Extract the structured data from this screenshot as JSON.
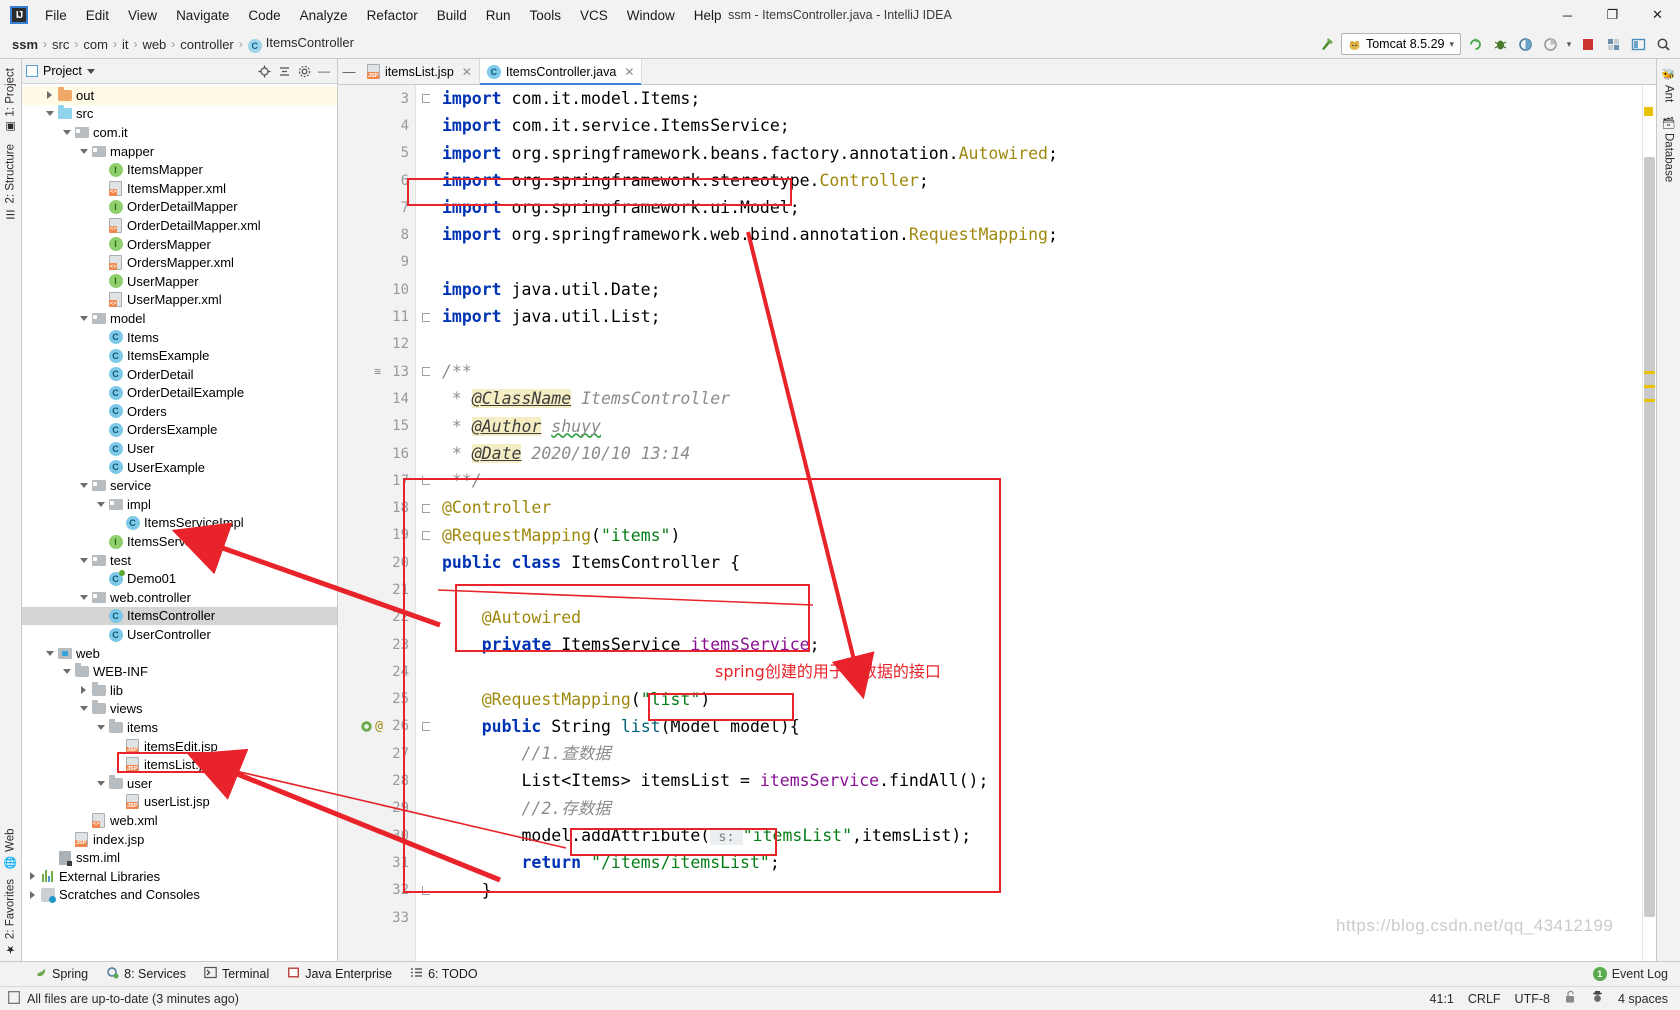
{
  "window": {
    "title": "ssm - ItemsController.java - IntelliJ IDEA",
    "minimize": "─",
    "maximize": "❐",
    "close": "✕"
  },
  "menu": {
    "items": [
      {
        "label": "File"
      },
      {
        "label": "Edit"
      },
      {
        "label": "View"
      },
      {
        "label": "Navigate"
      },
      {
        "label": "Code"
      },
      {
        "label": "Analyze"
      },
      {
        "label": "Refactor"
      },
      {
        "label": "Build"
      },
      {
        "label": "Run"
      },
      {
        "label": "Tools"
      },
      {
        "label": "VCS"
      },
      {
        "label": "Window"
      },
      {
        "label": "Help"
      }
    ]
  },
  "breadcrumb": {
    "items": [
      "ssm",
      "src",
      "com",
      "it",
      "web",
      "controller",
      "ItemsController"
    ],
    "separator": "›",
    "class_icon_letter": "C"
  },
  "toolbar": {
    "run_config": "Tomcat 8.5.29",
    "run_config_caret": "▾",
    "build_icon": "build-hammer-icon",
    "rerun_label": "↻",
    "debug_label": "🐞",
    "coverage_label": "◴",
    "profile_label": "◔",
    "stop_label": "■",
    "structure_label": "☰",
    "layout_label": "▣",
    "search_label": "🔍"
  },
  "project_panel": {
    "title": "Project",
    "caret": "▾",
    "actions": [
      "locate-icon",
      "collapse-all-icon",
      "settings-gear-icon",
      "hide-icon"
    ],
    "tree": [
      {
        "label": "out",
        "depth": 1,
        "twist": "right",
        "icon": "folder-orange",
        "highlight": true
      },
      {
        "label": "src",
        "depth": 1,
        "twist": "down",
        "icon": "source-folder-blue"
      },
      {
        "label": "com.it",
        "depth": 2,
        "twist": "down",
        "icon": "package"
      },
      {
        "label": "mapper",
        "depth": 3,
        "twist": "down",
        "icon": "package"
      },
      {
        "label": "ItemsMapper",
        "depth": 4,
        "twist": "none",
        "icon": "interface"
      },
      {
        "label": "ItemsMapper.xml",
        "depth": 4,
        "twist": "none",
        "icon": "xml-file"
      },
      {
        "label": "OrderDetailMapper",
        "depth": 4,
        "twist": "none",
        "icon": "interface"
      },
      {
        "label": "OrderDetailMapper.xml",
        "depth": 4,
        "twist": "none",
        "icon": "xml-file"
      },
      {
        "label": "OrdersMapper",
        "depth": 4,
        "twist": "none",
        "icon": "interface"
      },
      {
        "label": "OrdersMapper.xml",
        "depth": 4,
        "twist": "none",
        "icon": "xml-file"
      },
      {
        "label": "UserMapper",
        "depth": 4,
        "twist": "none",
        "icon": "interface"
      },
      {
        "label": "UserMapper.xml",
        "depth": 4,
        "twist": "none",
        "icon": "xml-file"
      },
      {
        "label": "model",
        "depth": 3,
        "twist": "down",
        "icon": "package"
      },
      {
        "label": "Items",
        "depth": 4,
        "twist": "none",
        "icon": "class"
      },
      {
        "label": "ItemsExample",
        "depth": 4,
        "twist": "none",
        "icon": "class"
      },
      {
        "label": "OrderDetail",
        "depth": 4,
        "twist": "none",
        "icon": "class"
      },
      {
        "label": "OrderDetailExample",
        "depth": 4,
        "twist": "none",
        "icon": "class"
      },
      {
        "label": "Orders",
        "depth": 4,
        "twist": "none",
        "icon": "class"
      },
      {
        "label": "OrdersExample",
        "depth": 4,
        "twist": "none",
        "icon": "class"
      },
      {
        "label": "User",
        "depth": 4,
        "twist": "none",
        "icon": "class"
      },
      {
        "label": "UserExample",
        "depth": 4,
        "twist": "none",
        "icon": "class"
      },
      {
        "label": "service",
        "depth": 3,
        "twist": "down",
        "icon": "package"
      },
      {
        "label": "impl",
        "depth": 4,
        "twist": "down",
        "icon": "package"
      },
      {
        "label": "ItemsServiceImpl",
        "depth": 5,
        "twist": "none",
        "icon": "class"
      },
      {
        "label": "ItemsService",
        "depth": 4,
        "twist": "none",
        "icon": "interface"
      },
      {
        "label": "test",
        "depth": 3,
        "twist": "down",
        "icon": "package"
      },
      {
        "label": "Demo01",
        "depth": 4,
        "twist": "none",
        "icon": "test-class"
      },
      {
        "label": "web.controller",
        "depth": 3,
        "twist": "down",
        "icon": "package"
      },
      {
        "label": "ItemsController",
        "depth": 4,
        "twist": "none",
        "icon": "class",
        "selected": true
      },
      {
        "label": "UserController",
        "depth": 4,
        "twist": "none",
        "icon": "class"
      },
      {
        "label": "web",
        "depth": 1,
        "twist": "down",
        "icon": "web-module"
      },
      {
        "label": "WEB-INF",
        "depth": 2,
        "twist": "down",
        "icon": "folder-gray"
      },
      {
        "label": "lib",
        "depth": 3,
        "twist": "right",
        "icon": "folder-gray"
      },
      {
        "label": "views",
        "depth": 3,
        "twist": "down",
        "icon": "folder-gray"
      },
      {
        "label": "items",
        "depth": 4,
        "twist": "down",
        "icon": "folder-gray"
      },
      {
        "label": "itemsEdit.jsp",
        "depth": 5,
        "twist": "none",
        "icon": "jsp-file"
      },
      {
        "label": "itemsList.jsp",
        "depth": 5,
        "twist": "none",
        "icon": "jsp-file",
        "annotated": true
      },
      {
        "label": "user",
        "depth": 4,
        "twist": "down",
        "icon": "folder-gray"
      },
      {
        "label": "userList.jsp",
        "depth": 5,
        "twist": "none",
        "icon": "jsp-file"
      },
      {
        "label": "web.xml",
        "depth": 3,
        "twist": "none",
        "icon": "xml-file"
      },
      {
        "label": "index.jsp",
        "depth": 2,
        "twist": "none",
        "icon": "jsp-file"
      },
      {
        "label": "ssm.iml",
        "depth": 1,
        "twist": "none",
        "icon": "iml-file"
      },
      {
        "label": "External Libraries",
        "depth": 0,
        "twist": "right",
        "icon": "library"
      },
      {
        "label": "Scratches and Consoles",
        "depth": 0,
        "twist": "right",
        "icon": "scratch"
      }
    ]
  },
  "left_strips": [
    {
      "label": "1: Project",
      "icon": "project-icon"
    },
    {
      "label": "2: Structure",
      "icon": "structure-icon"
    }
  ],
  "left_strips_bottom": [
    {
      "label": "Web",
      "icon": "globe-icon"
    },
    {
      "label": "2: Favorites",
      "icon": "star-icon"
    }
  ],
  "right_strips": [
    {
      "label": "Ant",
      "icon": "ant-icon"
    },
    {
      "label": "Database",
      "icon": "database-icon"
    }
  ],
  "editor": {
    "tabs": [
      {
        "label": "itemsList.jsp",
        "icon": "jsp-file",
        "active": false,
        "close": "✕"
      },
      {
        "label": "ItemsController.java",
        "icon": "class",
        "active": true,
        "close": "✕"
      }
    ],
    "first_line_number": 3,
    "lines": [
      {
        "n": 3,
        "fold": "fold-minus",
        "html": "<span class='kw'>import</span> com.it.model.Items;"
      },
      {
        "n": 4,
        "fold": "",
        "html": "<span class='kw'>import</span> com.it.service.ItemsService;"
      },
      {
        "n": 5,
        "fold": "",
        "html": "<span class='kw'>import</span> org.springframework.beans.factory.annotation.<span class='cls'>Autowired</span>;"
      },
      {
        "n": 6,
        "fold": "",
        "html": "<span class='kw'>import</span> org.springframework.stereotype.<span class='cls'>Controller</span>;"
      },
      {
        "n": 7,
        "fold": "",
        "html": "<span class='kw'>import</span> org.springframework.ui.Model;"
      },
      {
        "n": 8,
        "fold": "",
        "html": "<span class='kw'>import</span> org.springframework.web.bind.annotation.<span class='cls'>RequestMapping</span>;"
      },
      {
        "n": 9,
        "fold": "",
        "html": ""
      },
      {
        "n": 10,
        "fold": "",
        "html": "<span class='kw'>import</span> java.util.Date;"
      },
      {
        "n": 11,
        "fold": "fold-minus",
        "html": "<span class='kw'>import</span> java.util.List;"
      },
      {
        "n": 12,
        "fold": "",
        "html": ""
      },
      {
        "n": 13,
        "fold": "fold-minus",
        "gmark": "indent-guide-icon",
        "html": "<span class='jdoc'>/**</span>"
      },
      {
        "n": 14,
        "fold": "",
        "html": "<span class='jdoc'> * </span><span class='jtag'>@ClassName</span><span class='jdoc'> ItemsController</span>"
      },
      {
        "n": 15,
        "fold": "",
        "html": "<span class='jdoc'> * </span><span class='jtag'>@Author</span><span class='jdoc'> </span><span class='jdoc squiggly'>shuyy</span>"
      },
      {
        "n": 16,
        "fold": "",
        "html": "<span class='jdoc'> * </span><span class='jtag'>@Date</span><span class='jdoc'> 2020/10/10 13:14</span>"
      },
      {
        "n": 17,
        "fold": "fold-end",
        "html": "<span class='jdoc'> **/</span>"
      },
      {
        "n": 18,
        "fold": "fold-minus",
        "html": "<span class='anno'>@Controller</span>"
      },
      {
        "n": 19,
        "fold": "fold-minus",
        "html": "<span class='anno'>@RequestMapping</span>(<span class='str'>\"items\"</span>)"
      },
      {
        "n": 20,
        "fold": "",
        "html": "<span class='kw'>public</span> <span class='kw'>class</span> ItemsController {"
      },
      {
        "n": 21,
        "fold": "",
        "html": ""
      },
      {
        "n": 22,
        "fold": "",
        "html": "    <span class='anno'>@Autowired</span>"
      },
      {
        "n": 23,
        "fold": "",
        "html": "    <span class='kw'>private</span> ItemsService <span class='fld'>itemsService</span>;"
      },
      {
        "n": 24,
        "fold": "",
        "html": ""
      },
      {
        "n": 25,
        "fold": "",
        "html": "    <span class='anno'>@RequestMapping</span>(<span class='str'>\"list\"</span>)"
      },
      {
        "n": 26,
        "fold": "fold-minus",
        "gmark": "web-mapping-icon",
        "html": "    <span class='kw'>public</span> String <span class='mth'>list</span>(Model model){"
      },
      {
        "n": 27,
        "fold": "",
        "html": "        <span class='cmt'>//1.查数据</span>"
      },
      {
        "n": 28,
        "fold": "",
        "html": "        List&lt;Items&gt; itemsList = <span class='fld'>itemsService</span>.findAll();"
      },
      {
        "n": 29,
        "fold": "",
        "html": "        <span class='cmt'>//2.存数据</span>"
      },
      {
        "n": 30,
        "fold": "",
        "html": "        model.addAttribute(<span class='hintpar'> s: </span><span class='str'>\"itemsList\"</span>,itemsList);"
      },
      {
        "n": 31,
        "fold": "",
        "html": "        <span class='kw'>return</span> <span class='str'>\"/items/itemsList\"</span>;"
      },
      {
        "n": 32,
        "fold": "fold-end",
        "html": "    }"
      },
      {
        "n": 33,
        "fold": "",
        "html": ""
      }
    ]
  },
  "annotations": {
    "chinese_note": "spring创建的用于存数据的接口",
    "highlight_color": "#e8232a"
  },
  "bottom_tools": [
    {
      "label": "Spring",
      "icon": "spring-leaf-icon"
    },
    {
      "label": "8: Services",
      "icon": "services-icon"
    },
    {
      "label": "Terminal",
      "icon": "terminal-icon"
    },
    {
      "label": "Java Enterprise",
      "icon": "java-enterprise-icon"
    },
    {
      "label": "6: TODO",
      "icon": "todo-icon"
    }
  ],
  "statusbar": {
    "message": "All files are up-to-date (3 minutes ago)",
    "message_icon": "document-icon",
    "caret_position": "41:1",
    "line_separator": "CRLF",
    "encoding": "UTF-8",
    "lock_icon": "unlocked-icon",
    "inspection_icon": "hector-icon",
    "indent": "4 spaces",
    "event_log": "Event Log",
    "event_log_count": "1"
  },
  "watermark": "https://blog.csdn.net/qq_43412199"
}
